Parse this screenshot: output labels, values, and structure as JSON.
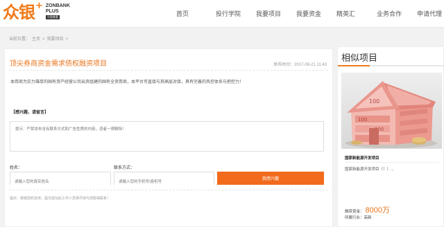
{
  "logo": {
    "cn": "众银",
    "plus_mark": "+",
    "en_line1": "ZONBANK",
    "en_line2": "PLUS",
    "tag": "众银普惠"
  },
  "nav": [
    "首页",
    "投行学院",
    "我要项目",
    "我要资金",
    "精英汇",
    "业务合作",
    "申请代理"
  ],
  "breadcrumb": {
    "prefix": "当前位置：",
    "home": "主页",
    "sep": ">",
    "current": "我要项目",
    "tail": ">"
  },
  "project": {
    "title": "顶尖券商资金需求债权融资项目",
    "publish_label": "发布时间：",
    "publish_time": "2017-08-21 11:43",
    "description": "本券商为实力雄厚的国有资产经营公司出资组建的国有全资券商，本平台可直接与其高层对接，具有完善的风控体系与把控力！"
  },
  "message": {
    "heading": "【感兴趣，请留言】",
    "placeholder": "提示：严禁发布含有联系方式和广告性质的内容，违者一律删除！",
    "name_label": "姓名：",
    "name_placeholder": "请输入您的真实姓名",
    "contact_label": "联系方式：",
    "contact_placeholder": "请输入您的手机号\\座机号",
    "submit_label": "我感兴趣",
    "tip": "提示：感谢您的支持，提交成功后工作人员将尽快与您取得联系！"
  },
  "sidebar": {
    "title": "相似项目",
    "accent": "#f07a1a",
    "item": {
      "name": "国家新能源开发项目",
      "description": "国家新能源开发项目（！）...",
      "amount_label": "融资资金：",
      "amount": "8000万",
      "industry_label": "所属行业：",
      "industry": "高新"
    }
  },
  "colors": {
    "brand": "#f07a1a",
    "button": "#f26b1d"
  }
}
